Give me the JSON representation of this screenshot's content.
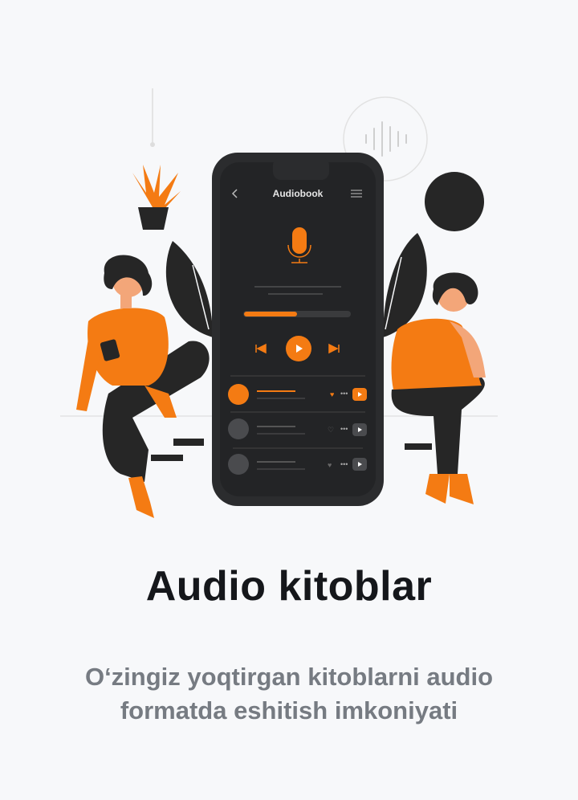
{
  "illustration": {
    "phone_header": "Audiobook",
    "progress_fraction": 0.5,
    "colors": {
      "accent": "#f47b13",
      "phone": "#2b2c2e",
      "screen": "#232426",
      "ink": "#262626"
    }
  },
  "title": "Audio kitoblar",
  "subtitle": "O‘zingiz yoqtirgan kitoblarni audio formatda eshitish imkoniyati"
}
